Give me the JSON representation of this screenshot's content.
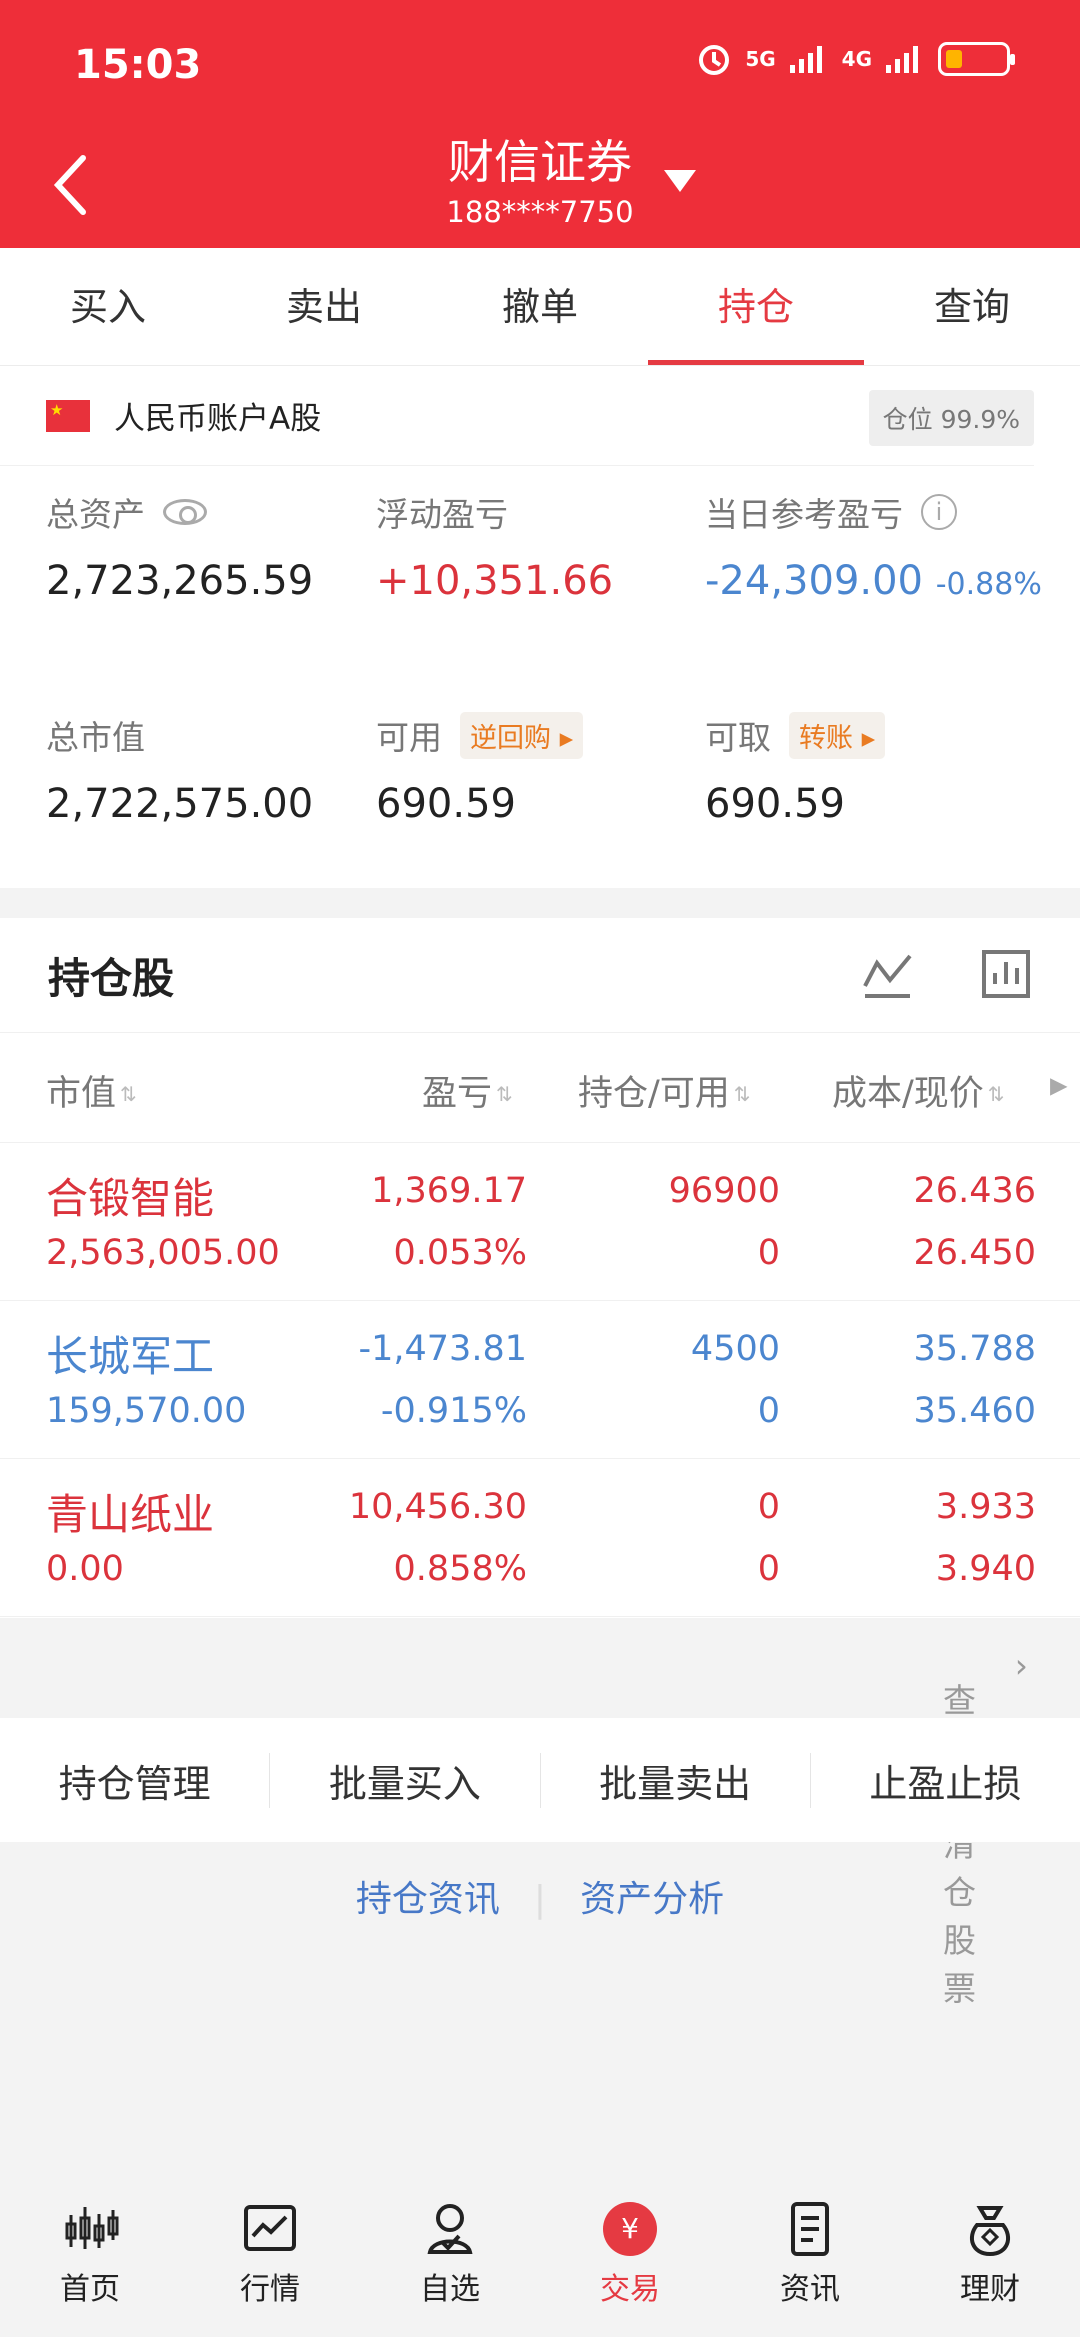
{
  "status": {
    "time": "15:03",
    "network_5g": "5G",
    "network_4g": "4G",
    "alarm_icon": "alarm-icon",
    "battery_icon": "battery-icon"
  },
  "header": {
    "title": "财信证券",
    "phone": "188****7750"
  },
  "tabs": [
    {
      "label": "买入"
    },
    {
      "label": "卖出"
    },
    {
      "label": "撤单"
    },
    {
      "label": "持仓"
    },
    {
      "label": "查询"
    }
  ],
  "account": {
    "name": "人民币账户A股",
    "position": "仓位 99.9%"
  },
  "metrics": {
    "total_assets_label": "总资产",
    "total_assets": "2,723,265.59",
    "floating_label": "浮动盈亏",
    "floating": "+10,351.66",
    "daily_label": "当日参考盈亏",
    "daily": "-24,309.00",
    "daily_pct": "-0.88%",
    "market_label": "总市值",
    "market": "2,722,575.00",
    "available_label": "可用",
    "reverse_repo": "逆回购",
    "available": "690.59",
    "withdraw_label": "可取",
    "transfer": "转账",
    "withdraw": "690.59"
  },
  "holdings": {
    "title": "持仓股",
    "headers": {
      "value": "市值",
      "profit": "盈亏",
      "quantity": "持仓/可用",
      "cost": "成本/现价"
    },
    "rows": [
      {
        "name": "合锻智能",
        "value": "2,563,005.00",
        "profit": "1,369.17",
        "profit_pct": "0.053%",
        "qty": "96900",
        "available": "0",
        "cost": "26.436",
        "price": "26.450"
      },
      {
        "name": "长城军工",
        "value": "159,570.00",
        "profit": "-1,473.81",
        "profit_pct": "-0.915%",
        "qty": "4500",
        "available": "0",
        "cost": "35.788",
        "price": "35.460"
      },
      {
        "name": "青山纸业",
        "value": "0.00",
        "profit": "10,456.30",
        "profit_pct": "0.858%",
        "qty": "0",
        "available": "0",
        "cost": "3.933",
        "price": "3.940"
      }
    ]
  },
  "cleared": "查看已清仓股票",
  "manage": [
    "持仓管理",
    "批量买入",
    "批量卖出",
    "止盈止损"
  ],
  "links": {
    "news": "持仓资讯",
    "analysis": "资产分析"
  },
  "nav": [
    {
      "label": "首页"
    },
    {
      "label": "行情"
    },
    {
      "label": "自选"
    },
    {
      "label": "交易",
      "symbol": "¥"
    },
    {
      "label": "资讯"
    },
    {
      "label": "理财"
    }
  ],
  "colors": {
    "brand": "#ee2e39",
    "profit": "#db333c",
    "loss": "#4b86cf"
  }
}
